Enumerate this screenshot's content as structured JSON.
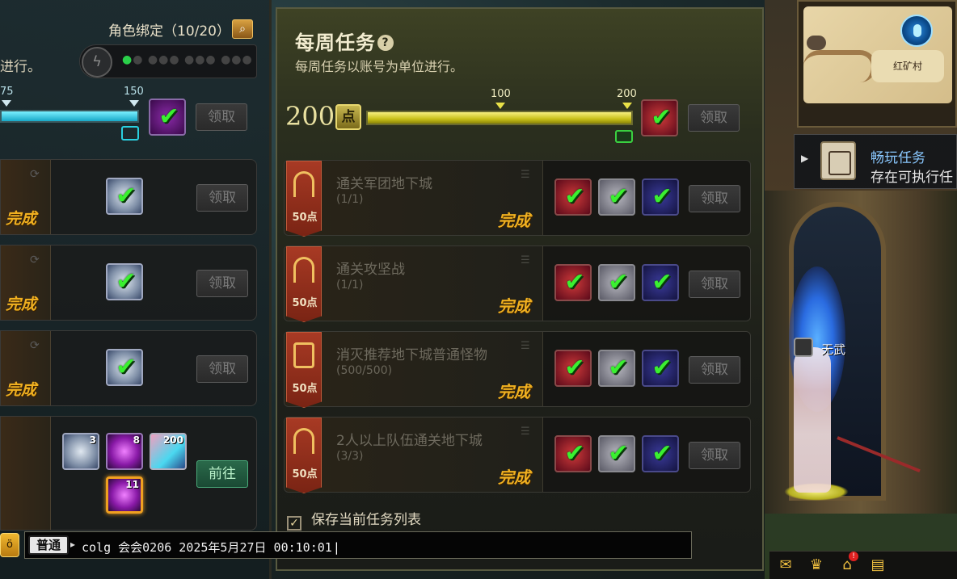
{
  "left_panel": {
    "title": "角色绑定（10/20）",
    "subtitle": "进行。",
    "progress": {
      "tick_low": "75",
      "tick_high": "150",
      "fill_fraction": 1.0
    },
    "claim_label": "领取",
    "done_label": "完成",
    "go_label": "前往",
    "reward_items": [
      {
        "icon": "gear-icon",
        "qty": "3"
      },
      {
        "icon": "purple-orb-icon",
        "qty": "8"
      },
      {
        "icon": "gem-icon",
        "qty": "200"
      },
      {
        "icon": "purple-orb-icon",
        "qty": "11"
      }
    ]
  },
  "weekly": {
    "title": "每周任务",
    "subtitle": "每周任务以账号为单位进行。",
    "points": "200",
    "points_unit": "点",
    "tick_mid": "100",
    "tick_max": "200",
    "progress_fraction": 1.0,
    "claim_label": "领取",
    "quests": [
      {
        "name": "通关军团地下城",
        "progress": "(1/1)",
        "points": "50点",
        "status": "完成"
      },
      {
        "name": "通关攻坚战",
        "progress": "(1/1)",
        "points": "50点",
        "status": "完成"
      },
      {
        "name": "消灭推荐地下城普通怪物",
        "progress": "(500/500)",
        "points": "50点",
        "status": "完成"
      },
      {
        "name": "2人以上队伍通关地下城",
        "progress": "(3/3)",
        "points": "50点",
        "status": "完成"
      }
    ],
    "save_label": "保存当前任务列表"
  },
  "notice": {
    "title": "畅玩任务",
    "desc": "存在可执行任"
  },
  "minimap": {
    "location": "红矿村"
  },
  "character": {
    "name": "无武"
  },
  "chat": {
    "channel": "普通",
    "text": "colg 会会0206 2025年5月27日 00:10:01"
  },
  "colors": {
    "done_gold": "#f0b020",
    "check_green": "#3af030",
    "bar_cyan": "#7af0ff",
    "bar_yellow": "#c8c018"
  }
}
